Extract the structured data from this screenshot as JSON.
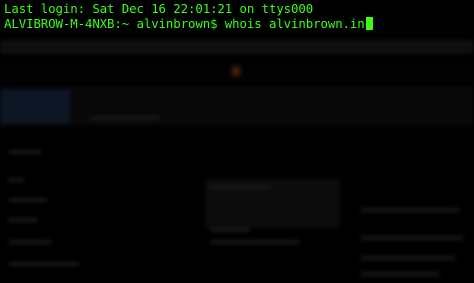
{
  "terminal": {
    "last_login": "Last login: Sat Dec 16 22:01:21 on ttys000",
    "prompt": "ALVIBROW-M-4NXB:~ alvinbrown$ ",
    "command": "whois alvinbrown.in"
  },
  "colors": {
    "text": "#39ff14",
    "background": "#000000"
  }
}
